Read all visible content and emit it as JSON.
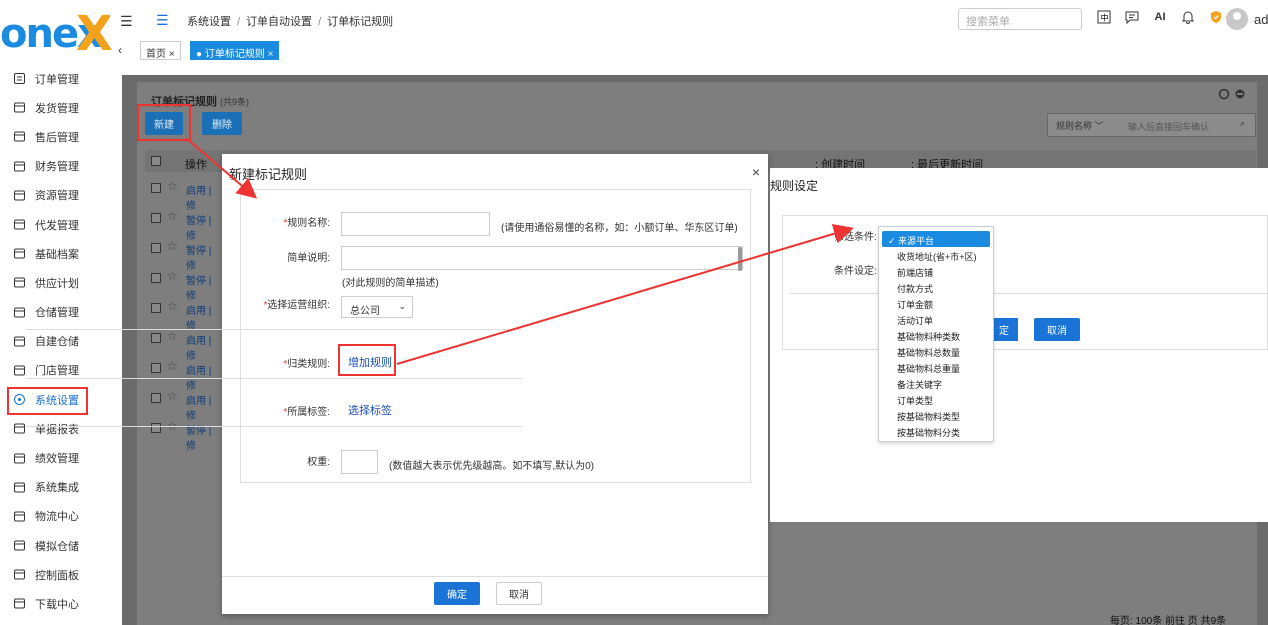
{
  "app": {
    "brand_text": "onex",
    "brand_x": "X"
  },
  "sidebar": {
    "items": [
      {
        "label": "订单管理",
        "icon": "list-icon"
      },
      {
        "label": "发货管理",
        "icon": "truck-icon"
      },
      {
        "label": "售后管理",
        "icon": "return-icon"
      },
      {
        "label": "财务管理",
        "icon": "yen-icon"
      },
      {
        "label": "资源管理",
        "icon": "grid-icon"
      },
      {
        "label": "代发管理",
        "icon": "forward-icon"
      },
      {
        "label": "基础档案",
        "icon": "archive-icon"
      },
      {
        "label": "供应计划",
        "icon": "plan-icon"
      },
      {
        "label": "仓储管理",
        "icon": "warehouse-icon"
      },
      {
        "label": "自建仓储",
        "icon": "home-icon"
      },
      {
        "label": "门店管理",
        "icon": "store-icon"
      },
      {
        "label": "系统设置",
        "icon": "settings-icon",
        "active": true
      },
      {
        "label": "单据报表",
        "icon": "report-icon"
      },
      {
        "label": "绩效管理",
        "icon": "chart-icon"
      },
      {
        "label": "系统集成",
        "icon": "integration-icon"
      },
      {
        "label": "物流中心",
        "icon": "logistics-icon"
      },
      {
        "label": "模拟仓储",
        "icon": "simulate-icon"
      },
      {
        "label": "控制面板",
        "icon": "dashboard-icon"
      },
      {
        "label": "下载中心",
        "icon": "download-icon"
      }
    ]
  },
  "topbar": {
    "breadcrumb": [
      "系统设置",
      "订单自动设置",
      "订单标记规则"
    ],
    "search_placeholder": "搜索菜单",
    "ai_label": "AI",
    "user": "ad"
  },
  "tabs": {
    "home": "首页 ×",
    "current": "● 订单标记规则 ×"
  },
  "list": {
    "title": "订单标记规则",
    "count": "(共9条)",
    "new_label": "新建",
    "delete_label": "删除",
    "filter_label": "规则名称 ﹀",
    "filter_placeholder": "输入后直接回车确认",
    "col_op": "操作",
    "col_created": "创建时间",
    "col_updated": "最后更新时间",
    "rows": [
      "启用 | 修",
      "暂停 | 修",
      "暂停 | 修",
      "暂停 | 修",
      "启用 | 修",
      "启用 | 修",
      "启用 | 修",
      "启用 | 修",
      "暂停 | 修"
    ],
    "pager": "每页: 100条   前往     页   共9条"
  },
  "modal": {
    "title": "新建标记规则",
    "close": "×",
    "rule_name_label": "规则名称:",
    "rule_name_hint": "(请使用通俗易懂的名称，如：小额订单、华东区订单)",
    "desc_label": "简单说明:",
    "desc_hint": "(对此规则的简单描述)",
    "org_label": "选择运营组织:",
    "org_value": "总公司",
    "classify_label": "归类规则:",
    "add_rule": "增加规则",
    "tag_label": "所属标签:",
    "select_tag": "选择标签",
    "weight_label": "权重:",
    "weight_hint": "(数值越大表示优先级越高。如不填写,默认为0)",
    "ok": "确定",
    "cancel": "取消"
  },
  "rule_dialog": {
    "title": "规则设定",
    "filter_label": "筛选条件:",
    "cond_label": "条件设定:",
    "ok": "定",
    "cancel": "取消",
    "options": [
      "✓ 来源平台",
      "收货地址(省+市+区)",
      "前端店铺",
      "付款方式",
      "订单金额",
      "活动订单",
      "基础物料种类数",
      "基础物料总数量",
      "基础物料总重量",
      "备注关键字",
      "订单类型",
      "按基础物料类型",
      "按基础物料分类"
    ]
  },
  "colors": {
    "accent": "#1a8be0",
    "brand_orange": "#f5a11a",
    "highlight": "#ee3333",
    "button": "#1a73d6"
  }
}
